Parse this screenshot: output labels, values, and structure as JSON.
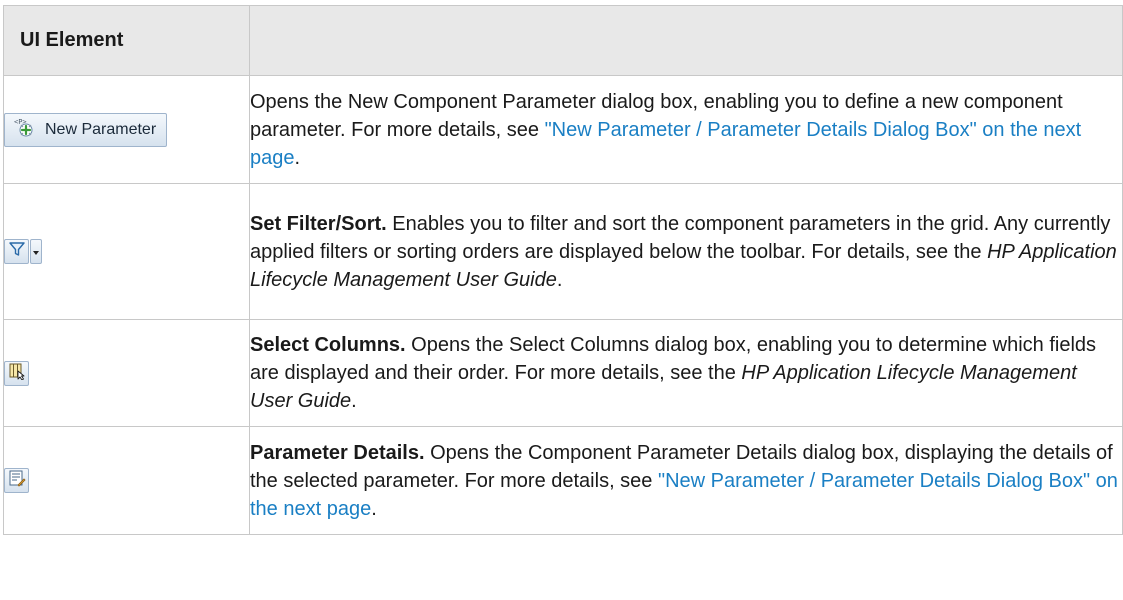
{
  "table": {
    "header": {
      "col1": "UI Element",
      "col2": ""
    },
    "rows": [
      {
        "element": {
          "type": "button",
          "label": "New Parameter",
          "icon": "new-parameter-icon"
        },
        "desc": {
          "text1": "Opens the New Component Parameter dialog box, enabling you to define a new component parameter. For more details, see ",
          "link": "\"New Parameter / Parameter Details Dialog Box\" on the next page",
          "text2": "."
        }
      },
      {
        "element": {
          "type": "icon-dropdown",
          "icon": "filter-icon",
          "dropdown_icon": "dropdown-arrow-icon"
        },
        "desc": {
          "bold": "Set Filter/Sort.",
          "text1": " Enables you to filter and sort the component parameters in the grid. Any currently applied filters or sorting orders are displayed below the toolbar. For details, see the ",
          "italic": "HP Application Lifecycle Management User Guide",
          "text2": "."
        }
      },
      {
        "element": {
          "type": "icon",
          "icon": "select-columns-icon"
        },
        "desc": {
          "bold": "Select Columns.",
          "text1": " Opens the Select Columns dialog box, enabling you to determine which fields are displayed and their order. For more details, see the ",
          "italic": "HP Application Lifecycle Management User Guide",
          "text2": "."
        }
      },
      {
        "element": {
          "type": "icon",
          "icon": "parameter-details-icon"
        },
        "desc": {
          "bold": "Parameter Details.",
          "text1": " Opens the Component Parameter Details dialog box, displaying the details of the selected parameter. For more details, see ",
          "link": "\"New Parameter / Parameter Details Dialog Box\" on the next page",
          "text2": "."
        }
      }
    ]
  },
  "colors": {
    "link": "#1a7fc4",
    "header_bg": "#e8e8e8",
    "border": "#c8c8c8"
  }
}
